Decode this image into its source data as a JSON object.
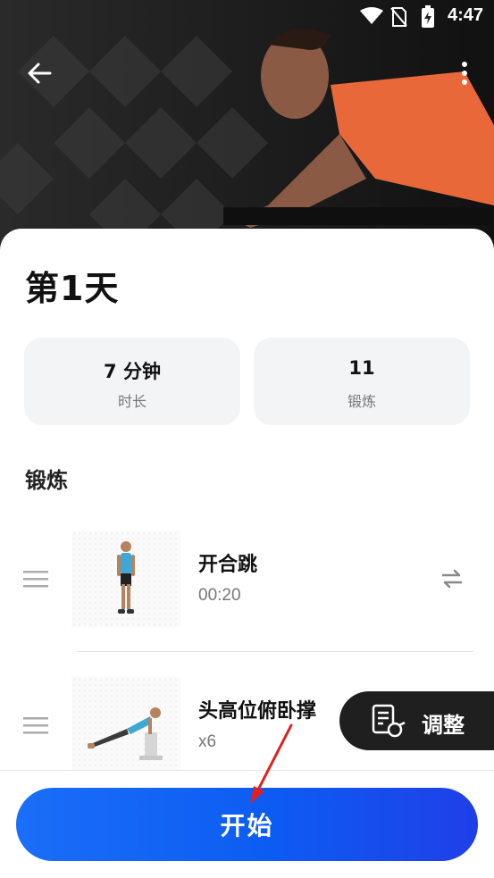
{
  "status_bar": {
    "time": "4:47"
  },
  "header": {
    "back_icon": "arrow-left-icon",
    "more_icon": "more-vert-icon"
  },
  "title": "第1天",
  "stats": [
    {
      "value": "7 分钟",
      "label": "时长"
    },
    {
      "value": "11",
      "label": "锻炼"
    }
  ],
  "section_title": "锻炼",
  "exercises": [
    {
      "name": "开合跳",
      "detail": "00:20"
    },
    {
      "name": "头高位俯卧撑",
      "detail": "x6"
    }
  ],
  "adjust": {
    "label": "调整"
  },
  "start_button": {
    "label": "开始"
  },
  "colors": {
    "accent": "#1a6ef7",
    "annotation_arrow": "#e02020"
  }
}
